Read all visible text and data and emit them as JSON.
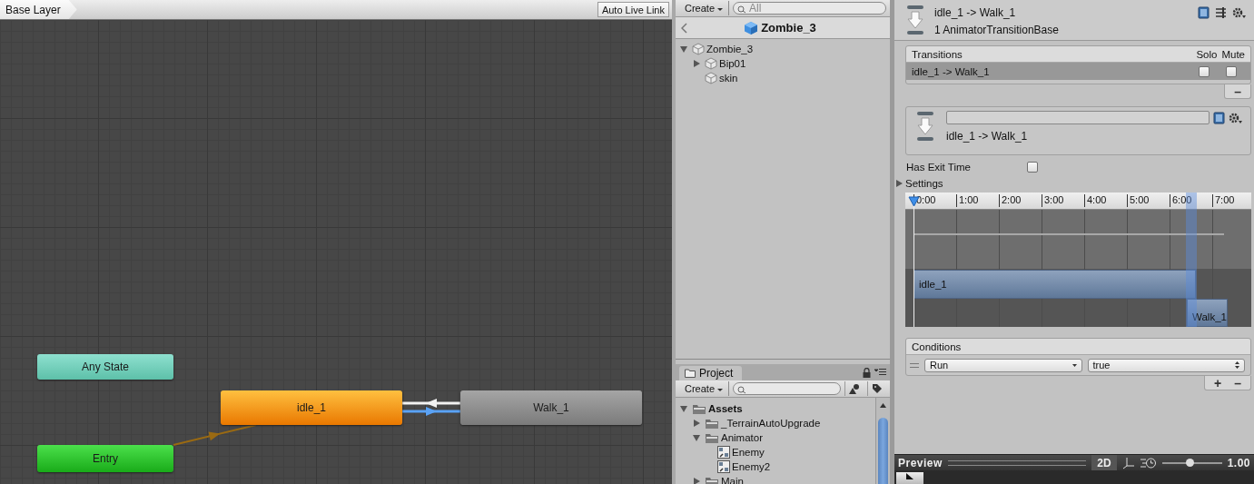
{
  "graph": {
    "breadcrumb": "Base Layer",
    "live_link_button": "Auto Live Link",
    "states": [
      {
        "label": "Any State",
        "kind": "any"
      },
      {
        "label": "idle_1",
        "kind": "default"
      },
      {
        "label": "Walk_1",
        "kind": "normal"
      },
      {
        "label": "Entry",
        "kind": "entry"
      }
    ],
    "transitions": [
      {
        "kind": "entry",
        "selected": false
      },
      {
        "kind": "state",
        "selected": false
      },
      {
        "kind": "state",
        "selected": true
      }
    ]
  },
  "hierarchy": {
    "create_button": "Create",
    "search": {
      "placeholder": "All"
    },
    "title": "Zombie_3",
    "tree": [
      {
        "label": "Zombie_3",
        "expanded": true,
        "children": [
          {
            "label": "Bip01",
            "expanded": false
          },
          {
            "label": "skin"
          }
        ]
      }
    ]
  },
  "project": {
    "tab": "Project",
    "create_button": "Create",
    "tree": [
      {
        "label": "Assets",
        "kind": "folder",
        "expanded": true,
        "children": [
          {
            "label": "_TerrainAutoUpgrade",
            "kind": "folder",
            "expanded": false
          },
          {
            "label": "Animator",
            "kind": "folder",
            "expanded": true,
            "children": [
              {
                "label": "Enemy",
                "kind": "controller"
              },
              {
                "label": "Enemy2",
                "kind": "controller"
              }
            ]
          },
          {
            "label": "Main",
            "kind": "folder",
            "expanded": false
          }
        ]
      }
    ]
  },
  "inspector": {
    "title": "idle_1 -> Walk_1",
    "subtitle": "1 AnimatorTransitionBase",
    "transitions_list": {
      "title": "Transitions",
      "solo_label": "Solo",
      "mute_label": "Mute",
      "rows": [
        {
          "label": "idle_1 -> Walk_1",
          "selected": true,
          "solo": false,
          "mute": false
        }
      ],
      "remove_button": "–"
    },
    "transition": {
      "label": "idle_1 -> Walk_1"
    },
    "has_exit_time": {
      "label": "Has Exit Time",
      "checked": false
    },
    "settings": {
      "label": "Settings",
      "expanded": false
    },
    "timeline": {
      "ticks": [
        "0:00",
        "1:00",
        "2:00",
        "3:00",
        "4:00",
        "5:00",
        "6:00",
        "7:00"
      ],
      "clips": [
        {
          "label": "idle_1"
        },
        {
          "label": "Walk_1"
        }
      ]
    },
    "conditions": {
      "title": "Conditions",
      "rows": [
        {
          "parameter": "Run",
          "value": "true"
        }
      ],
      "add_button": "+",
      "remove_button": "–"
    },
    "preview": {
      "title": "Preview",
      "mode_button": "2D",
      "speed": {
        "level": 0.46
      },
      "speed_reading": "1.00"
    }
  }
}
